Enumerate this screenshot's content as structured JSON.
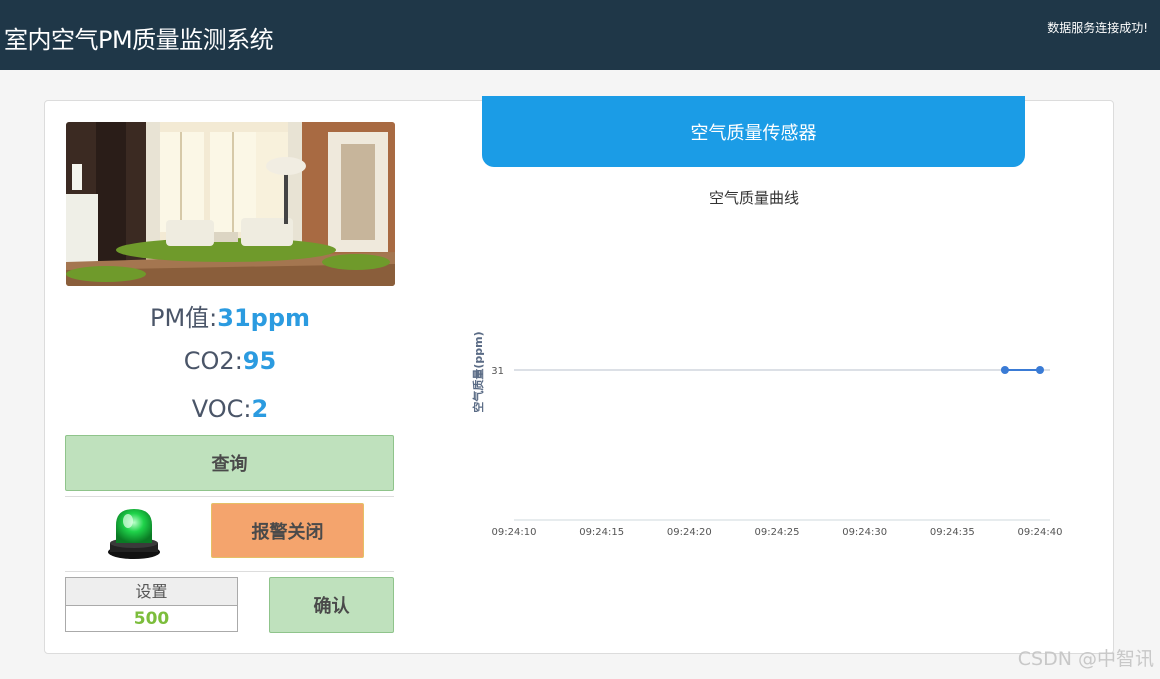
{
  "header": {
    "title": "室内空气PM质量监测系统",
    "status": "数据服务连接成功!"
  },
  "readings": {
    "pm_label": "PM值:",
    "pm_value": "31ppm",
    "co2_label": "CO2:",
    "co2_value": "95",
    "voc_label": "VOC:",
    "voc_value": "2"
  },
  "buttons": {
    "query": "查询",
    "alarm_off": "报警关闭",
    "confirm": "确认"
  },
  "settings": {
    "label": "设置",
    "value": "500"
  },
  "alarm": {
    "light_color": "#1fd34a",
    "state": "green"
  },
  "sensor": {
    "title": "空气质量传感器"
  },
  "chart_data": {
    "type": "line",
    "title": "空气质量曲线",
    "ylabel": "空气质量(ppm)",
    "xlabel": "",
    "x_ticks": [
      "09:24:10",
      "09:24:15",
      "09:24:20",
      "09:24:25",
      "09:24:30",
      "09:24:35",
      "09:24:40"
    ],
    "x_range": [
      "09:24:10",
      "09:24:40"
    ],
    "y_ticks": [
      31
    ],
    "series": [
      {
        "x": [
          "09:24:38",
          "09:24:40"
        ],
        "values": [
          31,
          31
        ],
        "color": "#3a7bd5"
      }
    ]
  },
  "watermark": "CSDN @中智讯",
  "colors": {
    "header_bg": "#1f3748",
    "accent_blue": "#1b9ce6",
    "value_blue": "#2b9be0",
    "button_green": "#bfe1bd",
    "button_orange": "#f4a46d",
    "setting_value": "#7cbd3c"
  }
}
